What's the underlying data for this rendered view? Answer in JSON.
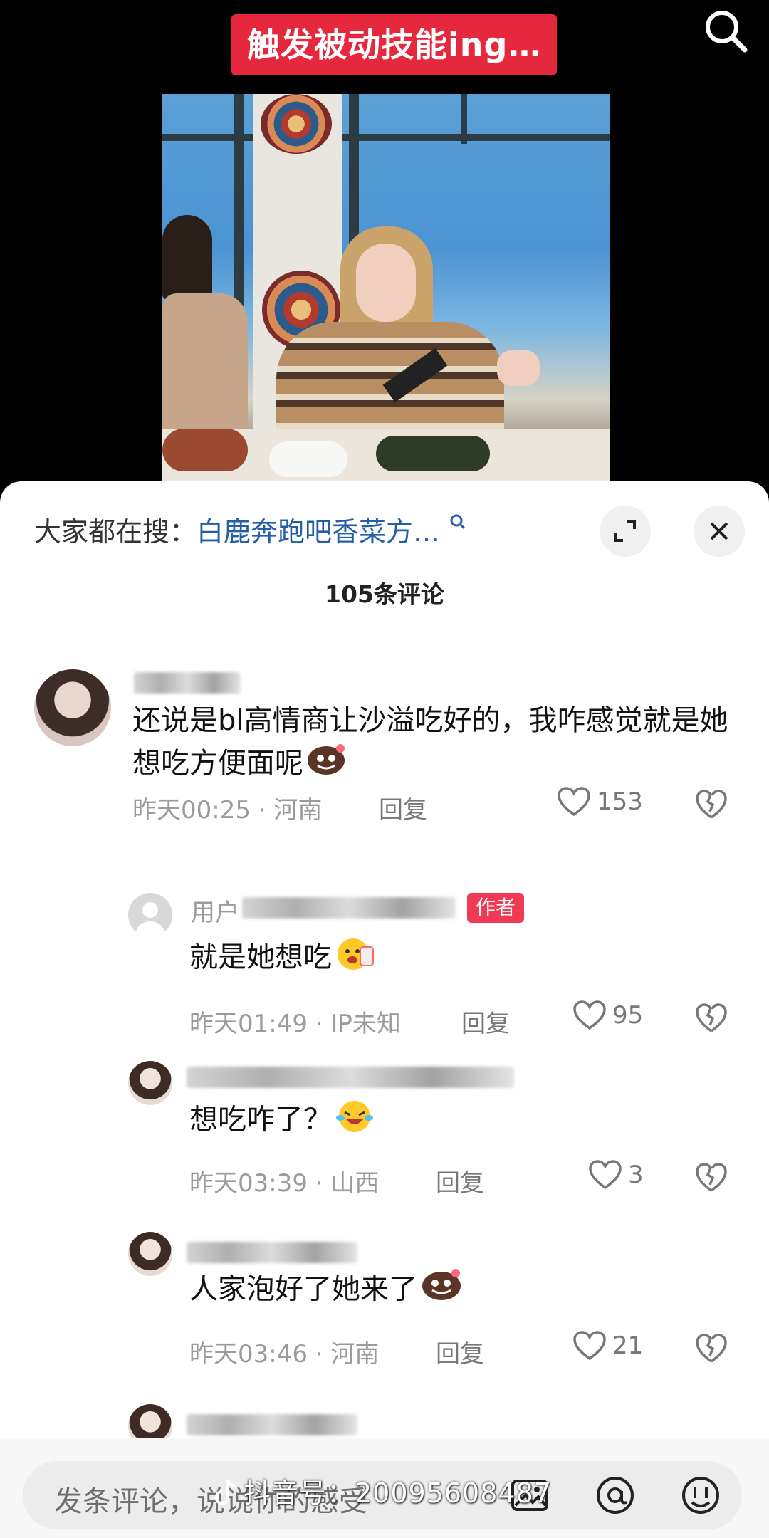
{
  "video": {
    "caption": "触发被动技能ing…",
    "search_icon": "search-icon"
  },
  "panel": {
    "search_prefix": "大家都在搜：",
    "search_query": "白鹿奔跑吧香菜方…",
    "comment_count": "105条评论"
  },
  "comments": [
    {
      "text": "还说是bl高情商让沙溢吃好的，我咋感觉就是她想吃方便面呢",
      "time_location": "昨天00:25 · 河南",
      "reply_label": "回复",
      "likes": "153"
    },
    {
      "name": "用户",
      "author_tag": "作者",
      "text": "就是她想吃",
      "time_location": "昨天01:49 · IP未知",
      "reply_label": "回复",
      "likes": "95"
    },
    {
      "text": "想吃咋了？",
      "time_location": "昨天03:39 · 山西",
      "reply_label": "回复",
      "likes": "3"
    },
    {
      "text": "人家泡好了她来了",
      "time_location": "昨天03:46 · 河南",
      "reply_label": "回复",
      "likes": "21"
    }
  ],
  "bottom_bar": {
    "placeholder": "发条评论，说说你的感受",
    "watermark": "抖音号：20095608487"
  }
}
